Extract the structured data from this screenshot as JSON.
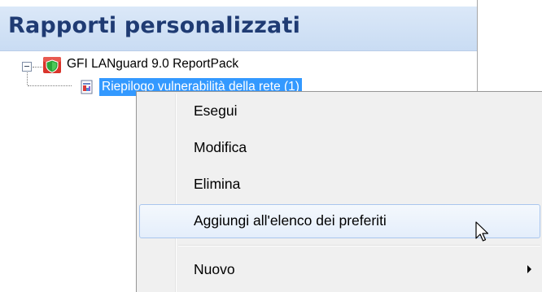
{
  "panel": {
    "header_title": "Rapporti personalizzati"
  },
  "tree": {
    "root": {
      "label": "GFI LANguard 9.0 ReportPack",
      "icon": "shield-icon",
      "expanded": true
    },
    "child": {
      "label": "Riepilogo vulnerabilità della rete (1)",
      "icon": "report-icon",
      "selected": true
    }
  },
  "context_menu": {
    "items": [
      {
        "label": "Esegui"
      },
      {
        "label": "Modifica"
      },
      {
        "label": "Elimina"
      },
      {
        "label": "Aggiungi all'elenco dei preferiti",
        "hovered": true
      },
      {
        "label": "Nuovo",
        "has_submenu": true
      }
    ]
  },
  "colors": {
    "selection": "#3399ff",
    "header_text": "#1f3b73",
    "header_bg": "#c9dcf3",
    "menu_bg": "#f0f0f0",
    "hover_border": "#a9c6ee"
  }
}
